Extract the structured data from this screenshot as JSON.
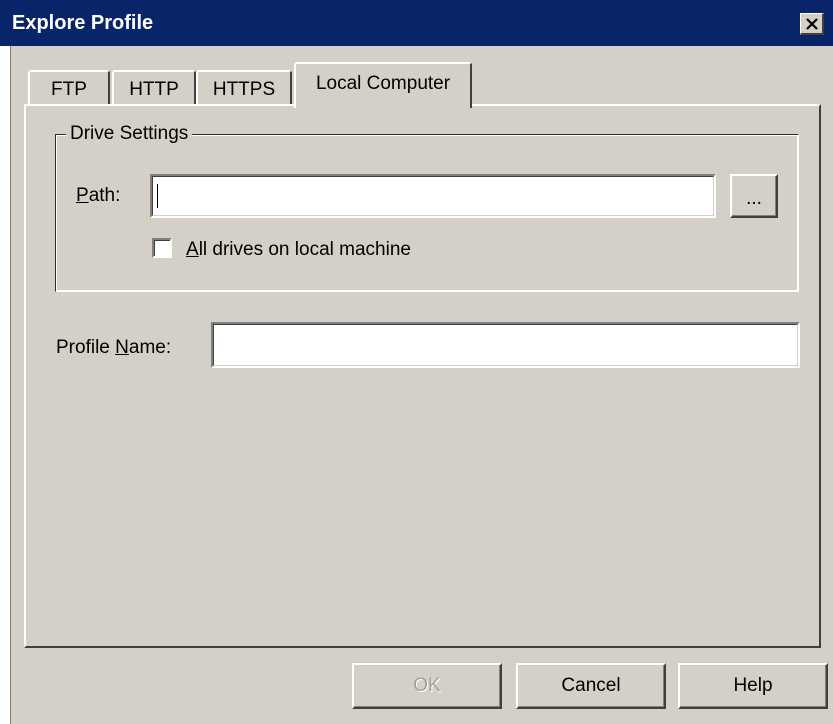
{
  "window": {
    "title": "Explore Profile",
    "close_symbol": "×"
  },
  "tabs": [
    {
      "label": "FTP",
      "selected": false
    },
    {
      "label": "HTTP",
      "selected": false
    },
    {
      "label": "HTTPS",
      "selected": false
    },
    {
      "label": "Local Computer",
      "selected": true
    }
  ],
  "drive_settings": {
    "legend": "Drive Settings",
    "path_label_prefix": "",
    "path_label_underlined": "P",
    "path_label_rest": "ath:",
    "path_value": "",
    "browse_label": "...",
    "all_drives_underlined": "A",
    "all_drives_rest": "ll drives on local machine",
    "all_drives_checked": false
  },
  "profile": {
    "label_prefix": "Profile ",
    "label_underlined": "N",
    "label_rest": "ame:",
    "value": ""
  },
  "buttons": {
    "ok": "OK",
    "cancel": "Cancel",
    "help": "Help"
  },
  "colors": {
    "title_bar": "#0a246a",
    "face": "#d4d0c8",
    "disabled_text": "#a0a0a0"
  }
}
